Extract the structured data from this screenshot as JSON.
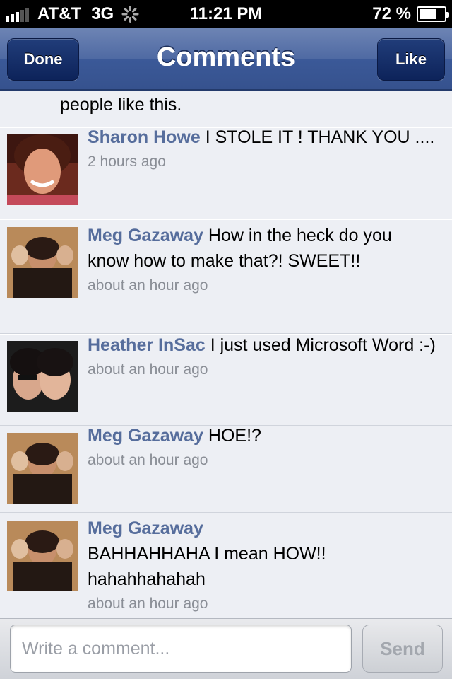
{
  "status_bar": {
    "carrier": "AT&T",
    "network": "3G",
    "time": "11:21 PM",
    "battery": "72 %",
    "battery_level": 0.72
  },
  "navbar": {
    "title": "Comments",
    "done_label": "Done",
    "like_label": "Like"
  },
  "likes_text": "people like this.",
  "comments": [
    {
      "author": "Sharon Howe",
      "text": "I STOLE IT ! THANK YOU ....",
      "time": "2 hours ago"
    },
    {
      "author": "Meg Gazaway",
      "text": "How in the heck do you know how to make that?! SWEET!!",
      "time": "about an hour ago"
    },
    {
      "author": "Heather InSac",
      "text": "I just used Microsoft Word :-)",
      "time": "about an hour ago"
    },
    {
      "author": "Meg Gazaway",
      "text": "HOE!?",
      "time": "about an hour ago"
    },
    {
      "author": "Meg Gazaway",
      "text": "BAHHAHHAHA I mean HOW!! hahahhahahah",
      "time": "about an hour ago"
    }
  ],
  "composer": {
    "placeholder": "Write a comment...",
    "value": "",
    "send_label": "Send"
  },
  "icons": {
    "signal": "signal-bars-icon",
    "activity": "activity-spinner-icon",
    "battery": "battery-icon"
  }
}
